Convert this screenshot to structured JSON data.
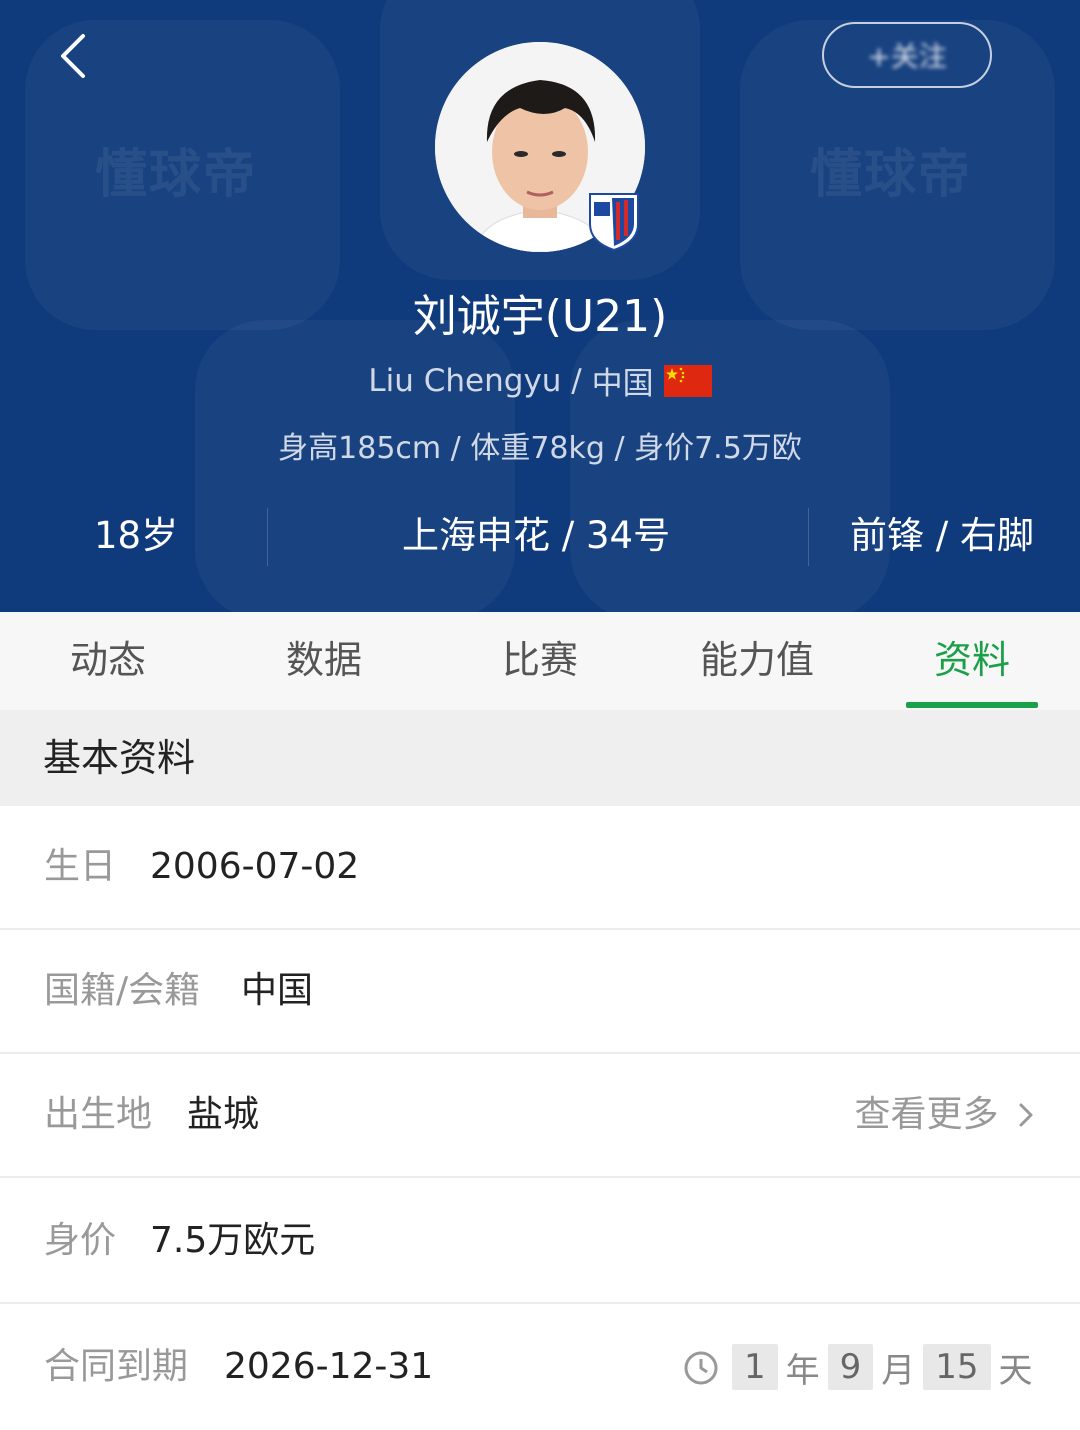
{
  "header": {
    "watermark_left": "懂球帝",
    "watermark_right": "懂球帝",
    "follow_label": "+关注",
    "player_name": "刘诚宇(U21)",
    "english_name": "Liu Chengyu",
    "country": "中国",
    "info_line": "身高185cm / 体重78kg / 身价7.5万欧",
    "stats": {
      "age": "18岁",
      "club_number": "上海申花 / 34号",
      "position_foot": "前锋 / 右脚"
    }
  },
  "tabs": [
    "动态",
    "数据",
    "比赛",
    "能力值",
    "资料"
  ],
  "active_tab": "资料",
  "section": {
    "title": "基本资料"
  },
  "rows": [
    {
      "label": "生日",
      "value": "2006-07-02"
    },
    {
      "label": "国籍/会籍",
      "value": "中国"
    },
    {
      "label": "出生地",
      "value": "盐城",
      "more": "查看更多"
    },
    {
      "label": "身价",
      "value": "7.5万欧元"
    },
    {
      "label": "合同到期",
      "value": "2026-12-31",
      "countdown": {
        "years": "1",
        "year_unit": "年",
        "months": "9",
        "month_unit": "月",
        "days": "15",
        "day_unit": "天"
      }
    }
  ],
  "colors": {
    "header_bg": "#0f3a7c",
    "accent": "#1aa049"
  }
}
